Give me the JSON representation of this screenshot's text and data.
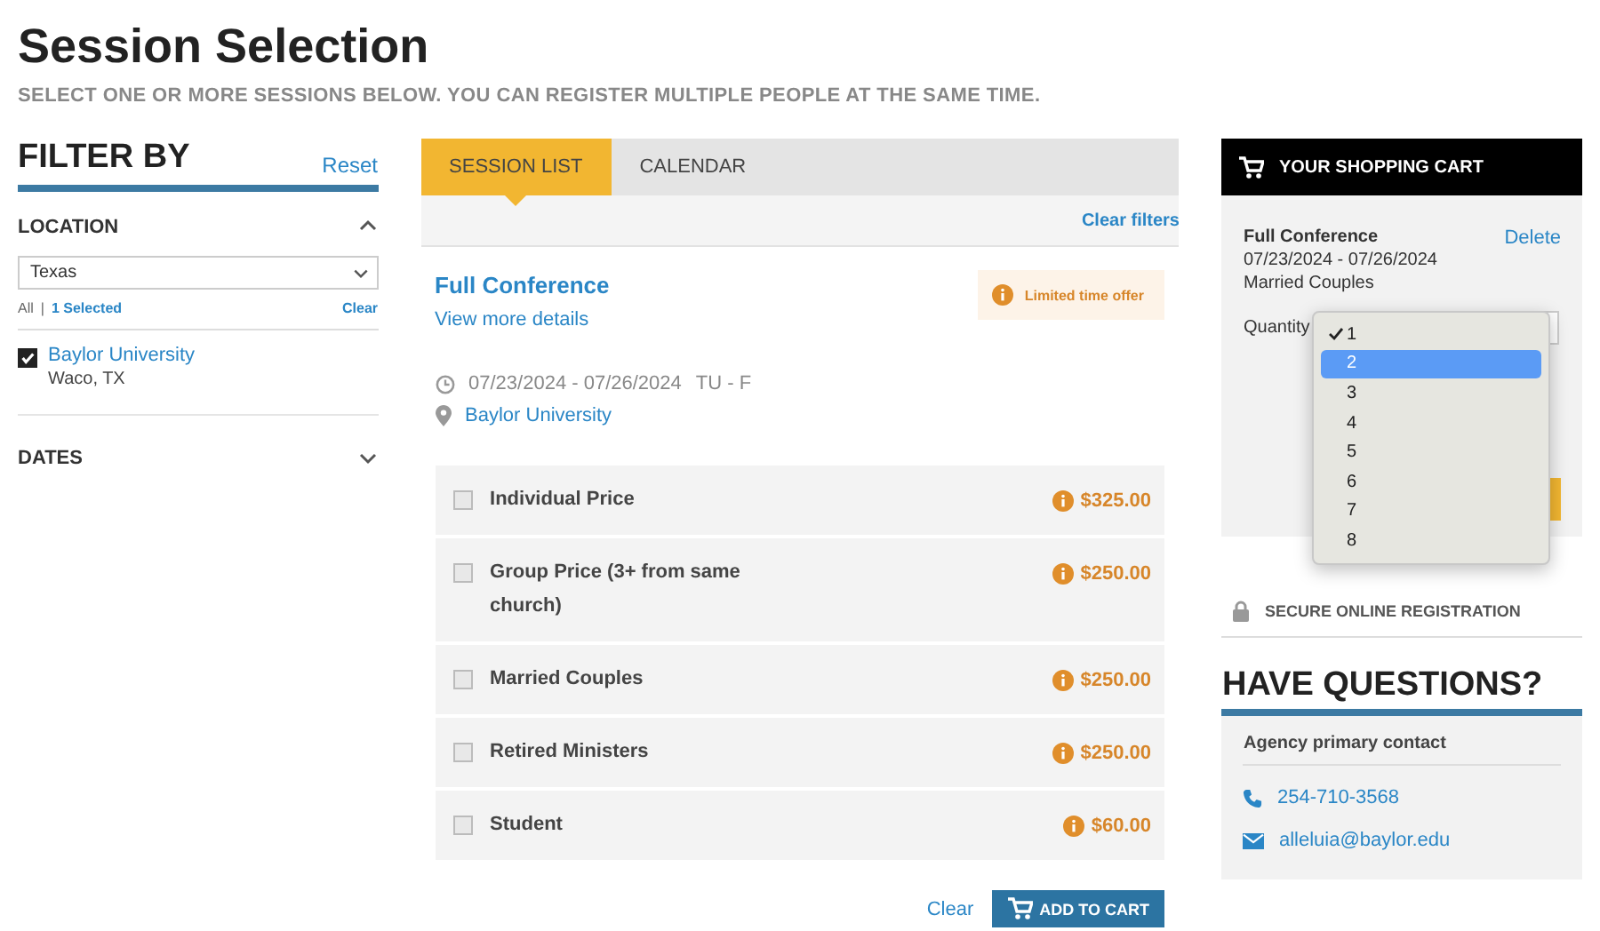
{
  "page": {
    "title": "Session Selection",
    "subtitle": "SELECT ONE OR MORE SESSIONS BELOW. YOU CAN REGISTER MULTIPLE PEOPLE AT THE SAME TIME."
  },
  "filter": {
    "title": "FILTER BY",
    "reset": "Reset",
    "location": {
      "label": "LOCATION",
      "expanded": true,
      "select_value": "Texas",
      "all": "All",
      "separator": "|",
      "selected_count": "1 Selected",
      "clear": "Clear",
      "options": [
        {
          "name": "Baylor University",
          "place": "Waco, TX",
          "checked": true
        }
      ]
    },
    "dates": {
      "label": "DATES",
      "expanded": false
    }
  },
  "tabs": [
    {
      "label": "SESSION LIST",
      "selected": true
    },
    {
      "label": "CALENDAR",
      "selected": false
    }
  ],
  "clear_filters": "Clear filters",
  "session": {
    "title": "Full Conference",
    "details_link": "View more details",
    "badge": "Limited time offer",
    "dates": "07/23/2024 - 07/26/2024",
    "days": "TU - F",
    "location": "Baylor University",
    "prices": [
      {
        "label": "Individual Price",
        "price": "$325.00",
        "checked": false
      },
      {
        "label": "Group Price (3+ from same church)",
        "price": "$250.00",
        "checked": false
      },
      {
        "label": "Married Couples",
        "price": "$250.00",
        "checked": false
      },
      {
        "label": "Retired Ministers",
        "price": "$250.00",
        "checked": false
      },
      {
        "label": "Student",
        "price": "$60.00",
        "checked": false
      }
    ],
    "clear": "Clear",
    "add_to_cart": "ADD TO CART"
  },
  "cart": {
    "title": "YOUR SHOPPING CART",
    "item": {
      "name": "Full Conference",
      "dates": "07/23/2024 - 07/26/2024",
      "price_type": "Married Couples",
      "delete": "Delete",
      "quantity_label": "Quantity"
    },
    "quantity_menu": [
      {
        "label": "1",
        "checked": true,
        "selected": false
      },
      {
        "label": "2",
        "checked": false,
        "selected": true
      },
      {
        "label": "3",
        "checked": false,
        "selected": false
      },
      {
        "label": "4",
        "checked": false,
        "selected": false
      },
      {
        "label": "5",
        "checked": false,
        "selected": false
      },
      {
        "label": "6",
        "checked": false,
        "selected": false
      },
      {
        "label": "7",
        "checked": false,
        "selected": false
      },
      {
        "label": "8",
        "checked": false,
        "selected": false
      }
    ]
  },
  "secure": "SECURE ONLINE REGISTRATION",
  "questions": {
    "title": "HAVE QUESTIONS?",
    "contact_label": "Agency primary contact",
    "phone": "254-710-3568",
    "email": "alleluia@baylor.edu"
  }
}
